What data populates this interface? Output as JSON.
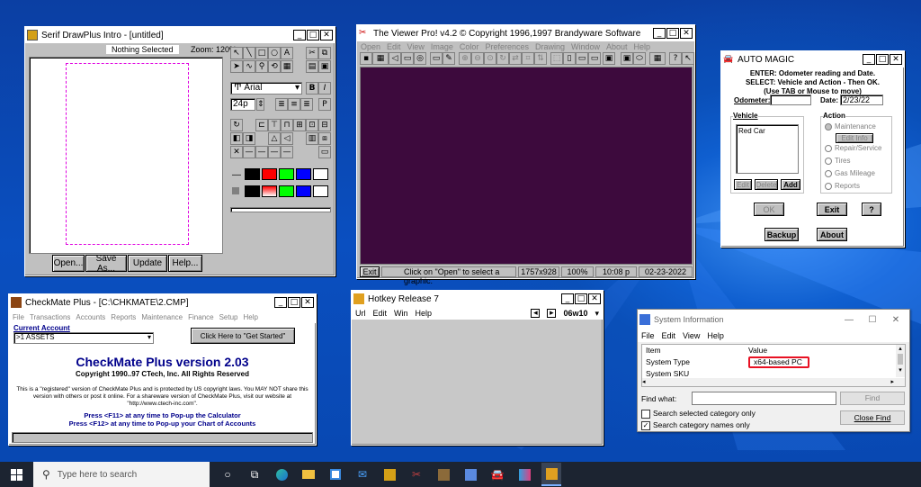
{
  "drawplus": {
    "title": "Serif DrawPlus Intro - [untitled]",
    "status": "Nothing Selected",
    "zoom": "Zoom: 120%",
    "font": "Arial",
    "size": "24p",
    "buttons": [
      "Open...",
      "Save As...",
      "Update",
      "Help..."
    ]
  },
  "viewer": {
    "title": "The Viewer Pro! v4.2  © Copyright 1996,1997 Brandyware Software",
    "menu": [
      "Open",
      "Edit",
      "View",
      "Image",
      "Color",
      "Preferences",
      "Drawing",
      "Window",
      "About",
      "Help"
    ],
    "exit": "Exit",
    "status": "Click on \"Open\" to select a graphic.",
    "dims": "1757x928",
    "zoom": "100%",
    "time": "10:08 p",
    "date": "02-23-2022",
    "canvas_color": "#3d0a3d"
  },
  "automagic": {
    "title": "AUTO MAGIC",
    "instr1": "ENTER: Odometer reading and Date.",
    "instr2": "SELECT: Vehicle and Action - Then OK.",
    "instr3": "(Use TAB or Mouse to move)",
    "odometer_label": "Odometer:",
    "date_label": "Date:",
    "date_value": "2/23/22",
    "vehicle_label": "Vehicle",
    "vehicle_item": "Red Car",
    "edit": "Edit",
    "delete": "Delete",
    "add": "Add",
    "action_label": "Action",
    "actions": [
      "Maintenance",
      "Repair/Service",
      "Tires",
      "Gas Mileage",
      "Reports"
    ],
    "edit_info": "Edit Info",
    "ok": "OK",
    "exit": "Exit",
    "help": "?",
    "backup": "Backup",
    "about": "About"
  },
  "checkmate": {
    "title": "CheckMate Plus - [C:\\CHKMATE\\2.CMP]",
    "menu": [
      "File",
      "Transactions",
      "Accounts",
      "Reports",
      "Maintenance",
      "Finance",
      "Setup",
      "Help"
    ],
    "current_account_label": "Current Account",
    "account": ">1 ASSETS",
    "get_started": "Click Here to \"Get Started\"",
    "heading": "CheckMate Plus version 2.03",
    "copyright": "Copyright 1990..97  CTech, Inc.  All Rights Reserved",
    "notice1": "This is a \"registered\" version of CheckMate Plus and is protected by US copyright laws.  You MAY NOT share this",
    "notice2": "version with others or post it online.  For a shareware version of CheckMate Plus, visit our website at",
    "notice3": "\"http://www.ctech-inc.com\".",
    "f11": "Press <F11> at any time to Pop-up the Calculator",
    "f12": "Press <F12> at any time to Pop-up your Chart of Accounts"
  },
  "hotkey": {
    "title": "Hotkey Release 7",
    "menu": [
      "Url",
      "Edit",
      "Win",
      "Help"
    ],
    "combo": "06w10"
  },
  "sysinfo": {
    "title": "System Information",
    "menu": [
      "File",
      "Edit",
      "View",
      "Help"
    ],
    "col_item": "Item",
    "col_value": "Value",
    "rows": [
      {
        "item": "System Type",
        "value": "x64-based PC"
      },
      {
        "item": "System SKU",
        "value": ""
      }
    ],
    "find_label": "Find what:",
    "find_button": "Find",
    "close_find": "Close Find",
    "opt1": "Search selected category only",
    "opt2": "Search category names only",
    "highlight_color": "#e81123"
  },
  "taskbar": {
    "search_placeholder": "Type here to search"
  }
}
